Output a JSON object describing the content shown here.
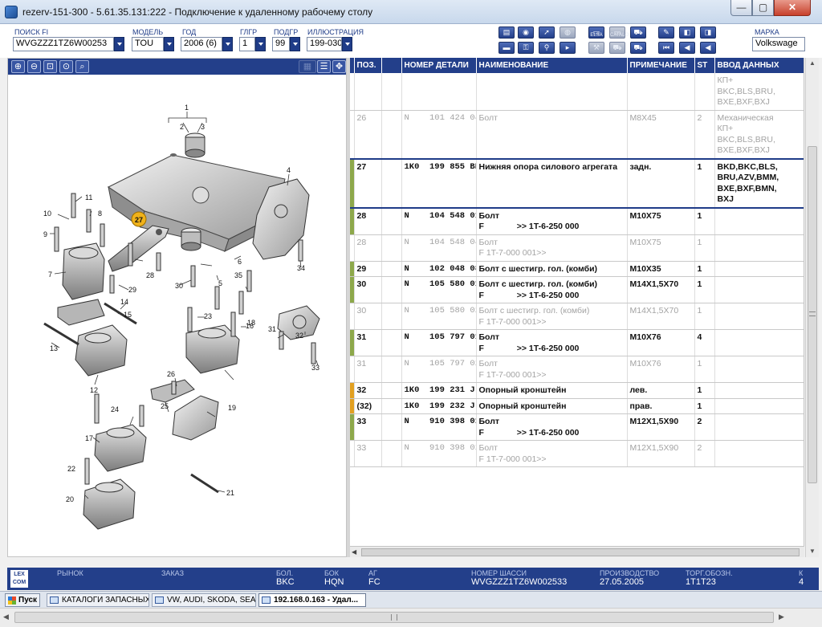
{
  "window": {
    "title": "rezerv-151-300 - 5.61.35.131:222 - Подключение к удаленному рабочему столу",
    "min_glyph": "—",
    "max_glyph": "▢",
    "close_glyph": "✕"
  },
  "filters": {
    "search_fi": {
      "label": "ПОИСК FI",
      "value": "WVGZZZ1TZ6W00253"
    },
    "model": {
      "label": "МОДЕЛЬ",
      "value": "TOU"
    },
    "year": {
      "label": "ГОД",
      "value": "2006 (6)"
    },
    "glgr": {
      "label": "ГЛГР",
      "value": "1"
    },
    "podgr": {
      "label": "ПОДГР",
      "value": "99"
    },
    "illustration": {
      "label": "ИЛЛЮСТРАЦИЯ",
      "value": "199-030"
    },
    "brand": {
      "label": "МАРКА",
      "value": "Volkswage"
    }
  },
  "toolbar": {
    "icons": [
      "print-icon",
      "search-parts-icon",
      "tag-icon",
      "car-icon",
      "elsa-icon",
      "catalog-icon",
      "cart-icon",
      "pin-icon",
      "prev-icon",
      "next-icon",
      "list-icon",
      "key-icon",
      "bike-icon",
      "arrow-icon",
      "tools-icon",
      "cart-grey-icon",
      "cart-add-icon",
      "first-icon",
      "back-icon",
      "left-icon"
    ],
    "elsa_label": "ELSA",
    "catalog_label": "CATALO"
  },
  "image_tools": {
    "icons": [
      "zoom-in-icon",
      "zoom-out-icon",
      "zoom-region-icon",
      "zoom-fit-icon",
      "magnifier-icon",
      "grid-view-icon",
      "list-view-icon",
      "move-icon"
    ]
  },
  "diagram": {
    "highlighted_position": "27",
    "callouts": [
      "1",
      "2",
      "3",
      "4",
      "5",
      "6",
      "7",
      "8",
      "9",
      "10",
      "11",
      "12",
      "13",
      "14",
      "15",
      "16",
      "17",
      "18",
      "19",
      "20",
      "21",
      "22",
      "23",
      "24",
      "25",
      "26",
      "28",
      "29",
      "30",
      "31",
      "32",
      "33",
      "34",
      "35"
    ]
  },
  "table": {
    "headers": [
      "ПОЗ.",
      "",
      "НОМЕР ДЕТАЛИ",
      "НАИМЕНОВАНИЕ",
      "ПРИМЕЧАНИЕ",
      "ST",
      "ВВОД ДАННЫХ"
    ],
    "rows": [
      {
        "pos": "",
        "pn": "",
        "name": "",
        "note": "",
        "st": "",
        "data": "КП+\nBKC,BLS,BRU,\nBXE,BXF,BXJ",
        "state": "inactive",
        "marker": ""
      },
      {
        "pos": "26",
        "pn": "N    101 424 04",
        "name": "Болт",
        "note": "M8X45",
        "st": "2",
        "data": "Механическая\nКП+\nBKC,BLS,BRU,\nBXE,BXF,BXJ",
        "state": "inactive",
        "marker": ""
      },
      {
        "pos": "27",
        "pn": "1K0  199 855 BB",
        "name": "Нижняя опора силового агрегата",
        "note": "задн.",
        "st": "1",
        "data": "BKD,BKC,BLS,\nBRU,AZV,BMM,\nBXE,BXF,BMN,\nBXJ",
        "state": "selected",
        "marker": "#8da84a"
      },
      {
        "pos": "28",
        "pn": "N    104 548 01",
        "name": "Болт\nF              >> 1T-6-250 000",
        "note": "M10X75",
        "st": "1",
        "data": "",
        "state": "active",
        "marker": "#8da84a"
      },
      {
        "pos": "28",
        "pn": "N    104 548 04",
        "name": "Болт\nF 1T-7-000 001>>",
        "note": "M10X75",
        "st": "1",
        "data": "",
        "state": "inactive",
        "marker": ""
      },
      {
        "pos": "29",
        "pn": "N    102 048 08",
        "name": "Болт с шестигр. гол. (комби)",
        "note": "M10X35",
        "st": "1",
        "data": "",
        "state": "active",
        "marker": "#8da84a"
      },
      {
        "pos": "30",
        "pn": "N    105 580 01",
        "name": "Болт с шестигр. гол. (комби)\nF              >> 1T-6-250 000",
        "note": "M14X1,5X70",
        "st": "1",
        "data": "",
        "state": "active",
        "marker": "#8da84a"
      },
      {
        "pos": "30",
        "pn": "N    105 580 02",
        "name": "Болт с шестигр. гол. (комби)\nF 1T-7-000 001>>",
        "note": "M14X1,5X70",
        "st": "1",
        "data": "",
        "state": "inactive",
        "marker": ""
      },
      {
        "pos": "31",
        "pn": "N    105 797 01",
        "name": "Болт\nF              >> 1T-6-250 000",
        "note": "M10X76",
        "st": "4",
        "data": "",
        "state": "active",
        "marker": "#8da84a"
      },
      {
        "pos": "31",
        "pn": "N    105 797 02",
        "name": "Болт\nF 1T-7-000 001>>",
        "note": "M10X76",
        "st": "1",
        "data": "",
        "state": "inactive",
        "marker": ""
      },
      {
        "pos": "32",
        "pn": "1K0  199 231 J",
        "name": "Опорный кронштейн",
        "note": "лев.",
        "st": "1",
        "data": "",
        "state": "active",
        "marker": "#e2a021"
      },
      {
        "pos": "(32)",
        "pn": "1K0  199 232 J",
        "name": "Опорный кронштейн",
        "note": "прав.",
        "st": "1",
        "data": "",
        "state": "active",
        "marker": "#e2a021"
      },
      {
        "pos": "33",
        "pn": "N    910 398 01",
        "name": "Болт\nF              >> 1T-6-250 000",
        "note": "M12X1,5X90",
        "st": "2",
        "data": "",
        "state": "active",
        "marker": "#8da84a"
      },
      {
        "pos": "33",
        "pn": "N    910 398 02",
        "name": "Болт\nF 1T-7-000 001>>",
        "note": "M12X1,5X90",
        "st": "2",
        "data": "",
        "state": "inactive",
        "marker": ""
      }
    ]
  },
  "status": {
    "logo": "LEX\nCOM",
    "market": {
      "label": "РЫНОК",
      "value": ""
    },
    "order": {
      "label": "ЗАКАЗ",
      "value": ""
    },
    "engine": {
      "label": "БОЛ.",
      "value": "BKC"
    },
    "gearbox": {
      "label": "БОК",
      "value": "HQN"
    },
    "ag": {
      "label": "АГ",
      "value": "FC"
    },
    "chassis": {
      "label": "НОМЕР ШАССИ",
      "value": "WVGZZZ1TZ6W002533"
    },
    "production": {
      "label": "ПРОИЗВОДСТВО",
      "value": "27.05.2005"
    },
    "trade": {
      "label": "ТОРГ.ОБОЗН.",
      "value": "1T1T23"
    },
    "extra": {
      "label": "К",
      "value": "4"
    }
  },
  "taskbar": {
    "start": "Пуск",
    "tasks": [
      "КАТАЛОГИ ЗАПАСНЫХ ...",
      "VW, AUDI, SKODA, SEAT",
      "192.168.0.163 - Удал..."
    ]
  }
}
